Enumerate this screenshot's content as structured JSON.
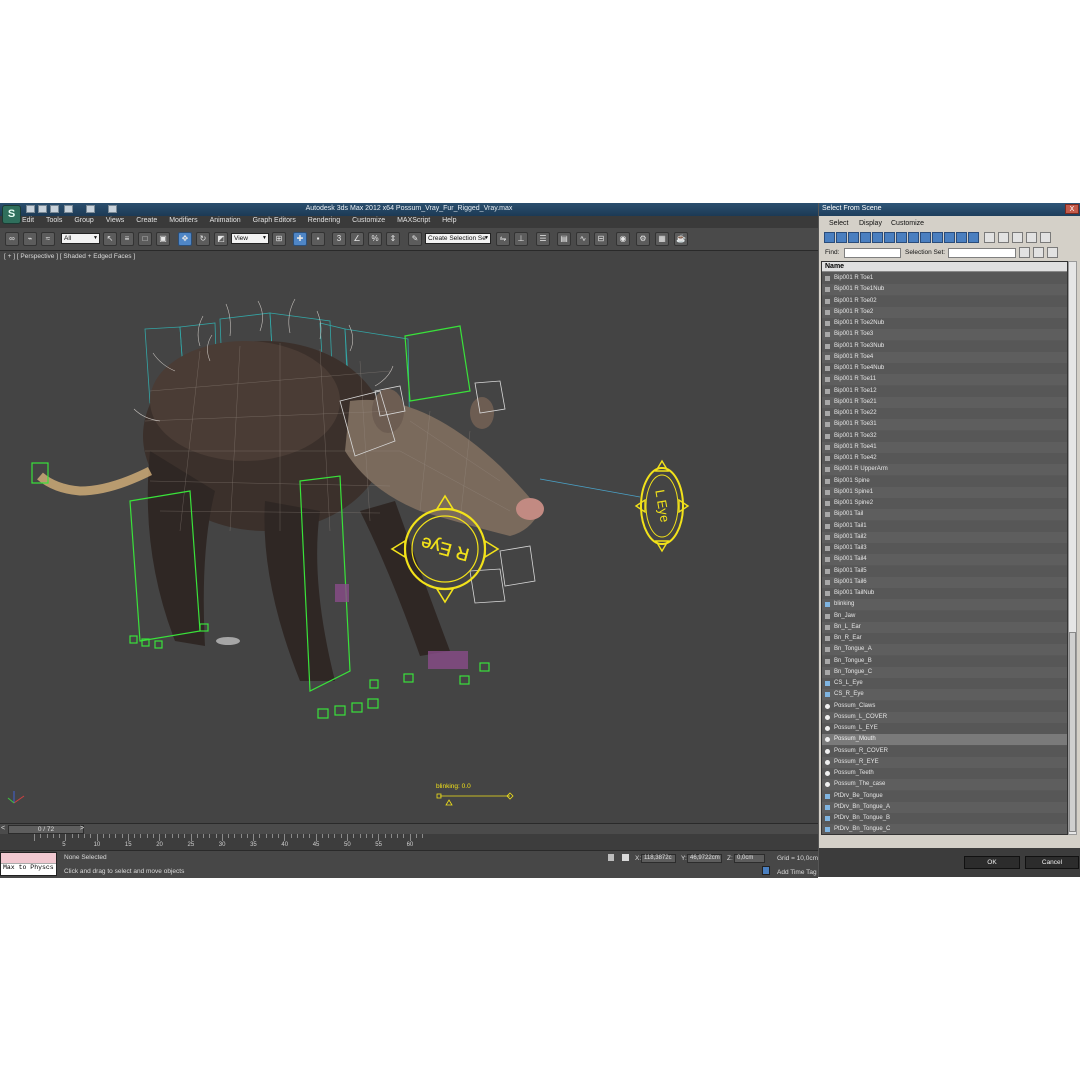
{
  "window": {
    "title": "Autodesk 3ds Max  2012 x64    Possum_Vray_Fur_Rigged_Vray.max",
    "app_icon": "3ds-max-logo-icon",
    "menu": [
      "Edit",
      "Tools",
      "Group",
      "Views",
      "Create",
      "Modifiers",
      "Animation",
      "Graph Editors",
      "Rendering",
      "Customize",
      "MAXScript",
      "Help"
    ]
  },
  "toolbar": {
    "selection_filter": "All",
    "reference_coord": "View",
    "named_selection": "Create Selection Se",
    "snap_label": "3",
    "angle_snap_label": "%"
  },
  "viewport": {
    "label": "[ + ] [ Perspective ] [ Shaded + Edged Faces ]",
    "r_eye_label": "R Eye",
    "l_eye_label": "L Eye",
    "blink_label": "blinking: 0.0",
    "accent_color": "#f2e21a"
  },
  "timeline": {
    "frame_counter": "0 / 72",
    "ticks": [
      "5",
      "10",
      "15",
      "20",
      "25",
      "30",
      "35",
      "40",
      "45",
      "50",
      "55",
      "60"
    ]
  },
  "status": {
    "maxscript_label": "Max to Physcs",
    "selection_status": "None Selected",
    "prompt": "Click and drag to select and move objects",
    "x_label": "X:",
    "x_value": "118,3872c",
    "y_label": "Y:",
    "y_value": "46,9722cm",
    "z_label": "Z:",
    "z_value": "0,0cm",
    "grid": "Grid = 10,0cm",
    "add_time_tag": "Add Time Tag"
  },
  "dialog": {
    "title": "Select From Scene",
    "close_label": "X",
    "menu": [
      "Select",
      "Display",
      "Customize"
    ],
    "find_label": "Find:",
    "selection_set_label": "Selection Set:",
    "column_header": "Name",
    "items": [
      {
        "name": "Bip001 R Toe1",
        "icon": "bone-icon"
      },
      {
        "name": "Bip001 R Toe1Nub",
        "icon": "bone-icon"
      },
      {
        "name": "Bip001 R Toe02",
        "icon": "bone-icon"
      },
      {
        "name": "Bip001 R Toe2",
        "icon": "bone-icon"
      },
      {
        "name": "Bip001 R Toe2Nub",
        "icon": "bone-icon"
      },
      {
        "name": "Bip001 R Toe3",
        "icon": "bone-icon"
      },
      {
        "name": "Bip001 R Toe3Nub",
        "icon": "bone-icon"
      },
      {
        "name": "Bip001 R Toe4",
        "icon": "bone-icon"
      },
      {
        "name": "Bip001 R Toe4Nub",
        "icon": "bone-icon"
      },
      {
        "name": "Bip001 R Toe11",
        "icon": "bone-icon"
      },
      {
        "name": "Bip001 R Toe12",
        "icon": "bone-icon"
      },
      {
        "name": "Bip001 R Toe21",
        "icon": "bone-icon"
      },
      {
        "name": "Bip001 R Toe22",
        "icon": "bone-icon"
      },
      {
        "name": "Bip001 R Toe31",
        "icon": "bone-icon"
      },
      {
        "name": "Bip001 R Toe32",
        "icon": "bone-icon"
      },
      {
        "name": "Bip001 R Toe41",
        "icon": "bone-icon"
      },
      {
        "name": "Bip001 R Toe42",
        "icon": "bone-icon"
      },
      {
        "name": "Bip001 R UpperArm",
        "icon": "bone-icon"
      },
      {
        "name": "Bip001 Spine",
        "icon": "bone-icon"
      },
      {
        "name": "Bip001 Spine1",
        "icon": "bone-icon"
      },
      {
        "name": "Bip001 Spine2",
        "icon": "bone-icon"
      },
      {
        "name": "Bip001 Tail",
        "icon": "bone-icon"
      },
      {
        "name": "Bip001 Tail1",
        "icon": "bone-icon"
      },
      {
        "name": "Bip001 Tail2",
        "icon": "bone-icon"
      },
      {
        "name": "Bip001 Tail3",
        "icon": "bone-icon"
      },
      {
        "name": "Bip001 Tail4",
        "icon": "bone-icon"
      },
      {
        "name": "Bip001 Tail5",
        "icon": "bone-icon"
      },
      {
        "name": "Bip001 Tail6",
        "icon": "bone-icon"
      },
      {
        "name": "Bip001 TailNub",
        "icon": "bone-icon"
      },
      {
        "name": "blinking",
        "icon": "helper-icon"
      },
      {
        "name": "Bn_Jaw",
        "icon": "bone-icon"
      },
      {
        "name": "Bn_L_Ear",
        "icon": "bone-icon"
      },
      {
        "name": "Bn_R_Ear",
        "icon": "bone-icon"
      },
      {
        "name": "Bn_Tongue_A",
        "icon": "bone-icon"
      },
      {
        "name": "Bn_Tongue_B",
        "icon": "bone-icon"
      },
      {
        "name": "Bn_Tongue_C",
        "icon": "bone-icon"
      },
      {
        "name": "CS_L_Eye",
        "icon": "helper-icon"
      },
      {
        "name": "CS_R_Eye",
        "icon": "helper-icon"
      },
      {
        "name": "Possum_Claws",
        "icon": "geometry-icon"
      },
      {
        "name": "Possum_L_COVER",
        "icon": "geometry-icon"
      },
      {
        "name": "Possum_L_EYE",
        "icon": "geometry-icon"
      },
      {
        "name": "Possum_Mouth",
        "icon": "geometry-icon",
        "selected": true
      },
      {
        "name": "Possum_R_COVER",
        "icon": "geometry-icon"
      },
      {
        "name": "Possum_R_EYE",
        "icon": "geometry-icon"
      },
      {
        "name": "Possum_Teeth",
        "icon": "geometry-icon"
      },
      {
        "name": "Possum_The_case",
        "icon": "geometry-icon"
      },
      {
        "name": "PtDrv_Be_Tongue",
        "icon": "helper-icon"
      },
      {
        "name": "PtDrv_Bn_Tongue_A",
        "icon": "helper-icon"
      },
      {
        "name": "PtDrv_Bn_Tongue_B",
        "icon": "helper-icon"
      },
      {
        "name": "PtDrv_Bn_Tongue_C",
        "icon": "helper-icon"
      }
    ],
    "ok_label": "OK",
    "cancel_label": "Cancel"
  }
}
